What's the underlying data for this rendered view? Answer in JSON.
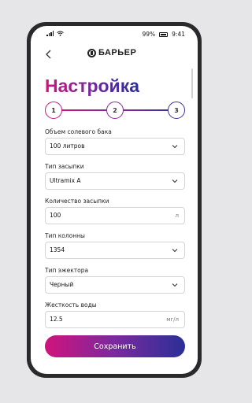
{
  "status": {
    "battery_percent": "99%",
    "time": "9:41"
  },
  "header": {
    "logo_text": "БАРЬЕР",
    "back_icon": "chevron-left-icon"
  },
  "page": {
    "title": "Настройка"
  },
  "stepper": {
    "steps": [
      "1",
      "2",
      "3"
    ],
    "current": 3,
    "colors": {
      "start": "#d0137c",
      "mid": "#6a2aa0",
      "end": "#2b2f97"
    }
  },
  "fields": [
    {
      "label": "Объем солевого бака",
      "value": "100 литров",
      "kind": "select"
    },
    {
      "label": "Тип засыпки",
      "value": "Ultramix A",
      "kind": "select"
    },
    {
      "label": "Количество засыпки",
      "value": "100",
      "unit": "л",
      "kind": "input"
    },
    {
      "label": "Тип колонны",
      "value": "1354",
      "kind": "select"
    },
    {
      "label": "Тип эжектора",
      "value": "Черный",
      "kind": "select"
    },
    {
      "label": "Жесткость воды",
      "value": "12.5",
      "unit": "мг/л",
      "kind": "input"
    }
  ],
  "actions": {
    "save_label": "Сохранить"
  }
}
